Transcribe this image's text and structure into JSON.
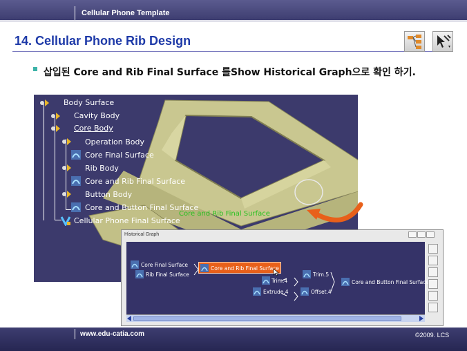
{
  "header": {
    "template_title": "Cellular Phone Template",
    "page_title": "14. Cellular Phone Rib Design"
  },
  "bullet": {
    "text": "삽입된 Core and Rib Final Surface 를Show Historical Graph으로 확인 하기."
  },
  "spec_tree": {
    "items": [
      {
        "label": "Body Surface"
      },
      {
        "label": "Cavity Body"
      },
      {
        "label": "Core Body"
      },
      {
        "label": "Operation Body"
      },
      {
        "label": "Core Final Surface"
      },
      {
        "label": "Rib Body"
      },
      {
        "label": "Core and Rib Final Surface"
      },
      {
        "label": "Button Body"
      },
      {
        "label": "Core and Button Final Surface"
      },
      {
        "label": "Cellular Phone Final Surface"
      }
    ]
  },
  "scene_label": "Core and Rib Final Surface",
  "historical_graph": {
    "title": "Historical Graph",
    "nodes": [
      {
        "label": "Core Final Surface"
      },
      {
        "label": "Rib Final Surface"
      },
      {
        "label": "Core and Rib Final Surface"
      },
      {
        "label": "Trim.4"
      },
      {
        "label": "Extrude.4"
      },
      {
        "label": "Trim.5"
      },
      {
        "label": "Offset.4"
      },
      {
        "label": "Core and Button Final Surface"
      }
    ]
  },
  "footer": {
    "url": "www.edu-catia.com",
    "copyright": "©2009. LCS"
  },
  "colors": {
    "header_bg": "#4a4a80",
    "title": "#1e3aa8",
    "scene_bg": "#3c3a6c",
    "highlight": "#e8601a",
    "scene_label": "#26c11f"
  }
}
